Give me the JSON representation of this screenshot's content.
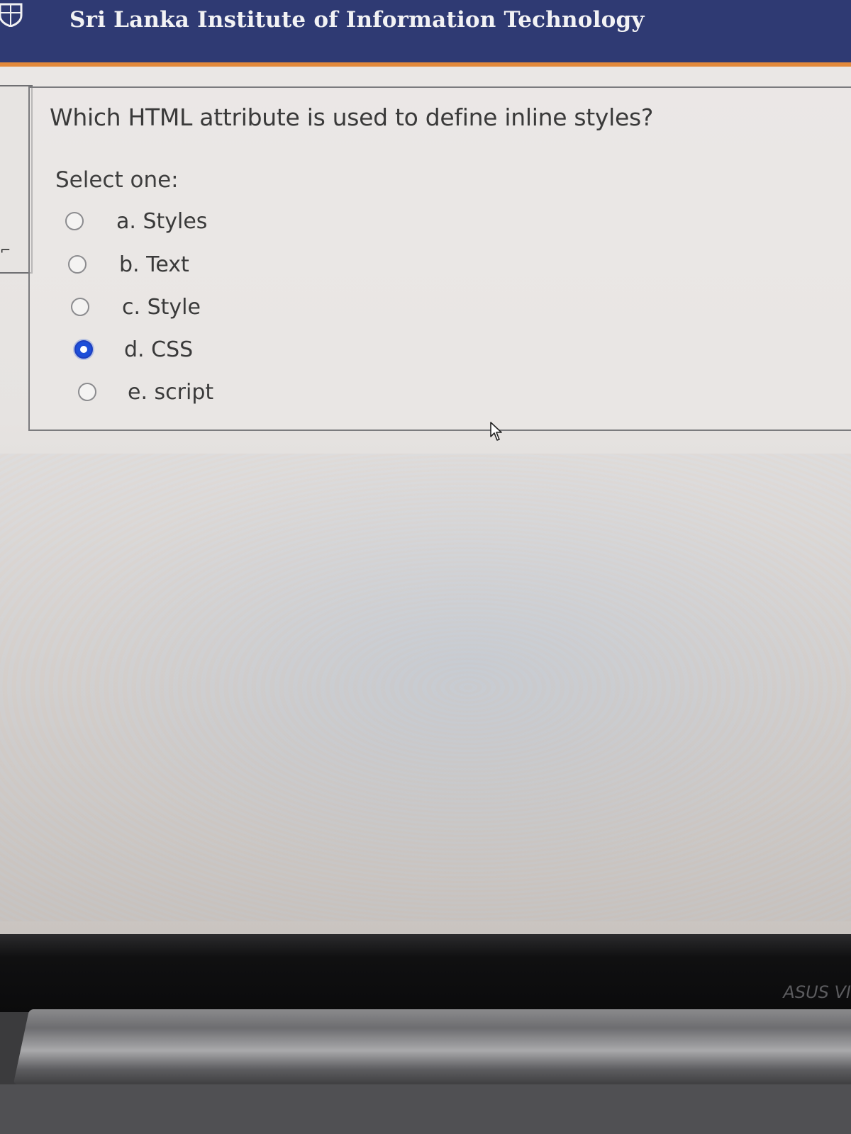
{
  "header": {
    "title": "Sri Lanka Institute of Information Technology"
  },
  "question": {
    "text": "Which HTML attribute is used to define inline styles?",
    "select_label": "Select one:",
    "options": [
      {
        "label": "a. Styles",
        "checked": false
      },
      {
        "label": "b. Text",
        "checked": false
      },
      {
        "label": "c. Style",
        "checked": false
      },
      {
        "label": "d. CSS",
        "checked": true
      },
      {
        "label": "e. script",
        "checked": false
      }
    ]
  },
  "laptop": {
    "brand": "ASUS VI"
  },
  "colors": {
    "header_bg": "#2f3a73",
    "header_accent": "#e2893b",
    "radio_checked": "#1d4ed8"
  }
}
